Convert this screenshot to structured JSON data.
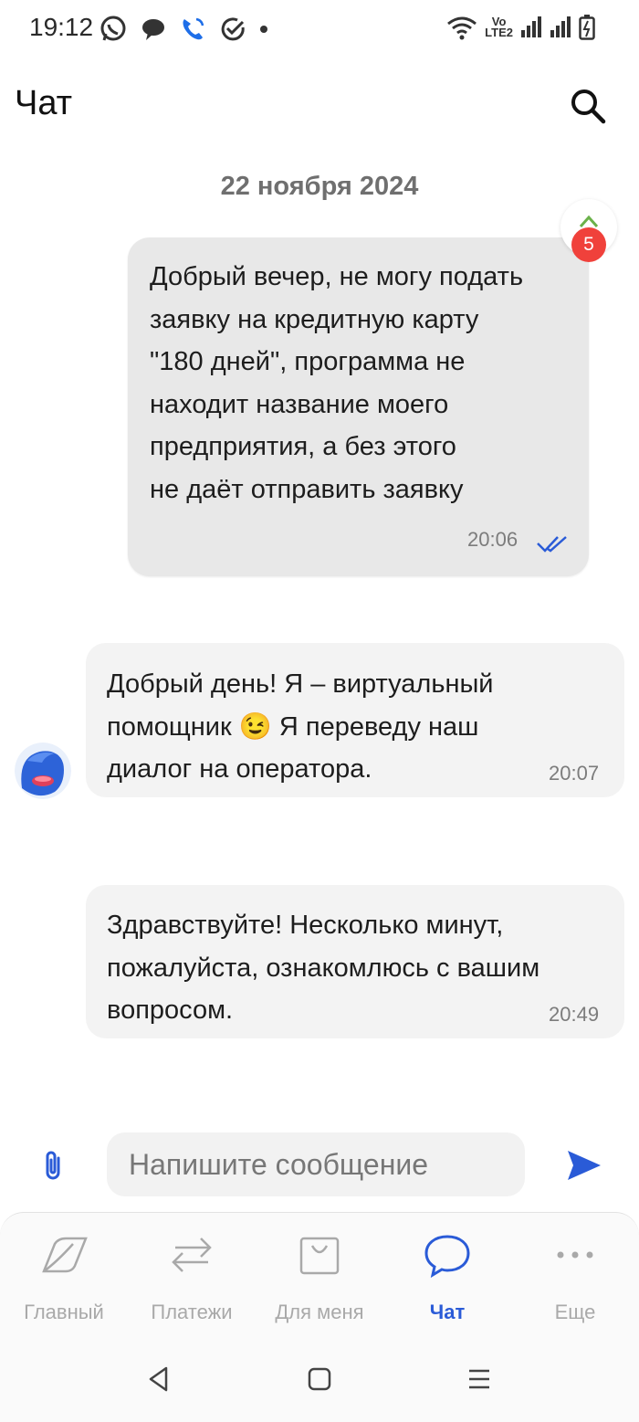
{
  "status_bar": {
    "time": "19:12",
    "left_icons": [
      "whatsapp-icon",
      "chat-bubble-icon",
      "phone-icon",
      "check-circle-icon",
      "dot-icon"
    ],
    "right_icons": [
      "wifi-icon",
      "volte-icon",
      "signal-icon",
      "signal-icon",
      "battery-icon"
    ],
    "volte_top": "Vo",
    "volte_bottom": "LTE2"
  },
  "header": {
    "title": "Чат",
    "search_icon": "search-icon"
  },
  "chat": {
    "date_separator": "22 ноября 2024",
    "scroll_unread_count": "5",
    "messages": [
      {
        "direction": "outgoing",
        "lines": [
          "Добрый вечер, не могу подать",
          "заявку на кредитную карту",
          "\"180 дней\", программа не",
          "находит название моего",
          "предприятия, а без этого",
          "не даёт отправить заявку"
        ],
        "time": "20:06",
        "status_icon": "double-check-icon"
      },
      {
        "direction": "incoming",
        "lines": [
          "Добрый день! Я – виртуальный",
          "помощник 😉 Я переведу наш",
          "диалог на оператора."
        ],
        "time": "20:07",
        "avatar_icon": "bot-avatar-icon"
      },
      {
        "direction": "incoming",
        "lines": [
          "Здравствуйте! Несколько минут,",
          "пожалуйста, ознакомлюсь с вашим",
          "вопросом."
        ],
        "time": "20:49"
      }
    ]
  },
  "composer": {
    "placeholder": "Напишите сообщение",
    "value": "",
    "attach_icon": "paperclip-icon",
    "send_icon": "send-icon"
  },
  "bottom_nav": {
    "items": [
      {
        "label": "Главный",
        "icon": "home-leaf-icon",
        "active": false
      },
      {
        "label": "Платежи",
        "icon": "transfer-arrows-icon",
        "active": false
      },
      {
        "label": "Для меня",
        "icon": "shopping-bag-icon",
        "active": false
      },
      {
        "label": "Чат",
        "icon": "chat-icon",
        "active": true
      },
      {
        "label": "Еще",
        "icon": "more-dots-icon",
        "active": false
      }
    ]
  },
  "system_nav": [
    "back-icon",
    "home-icon",
    "recents-icon"
  ],
  "colors": {
    "accent": "#2a5bd7",
    "badge": "#f0413b",
    "outgoing_bubble": "#e8e8e8",
    "incoming_bubble": "#f3f3f3"
  }
}
